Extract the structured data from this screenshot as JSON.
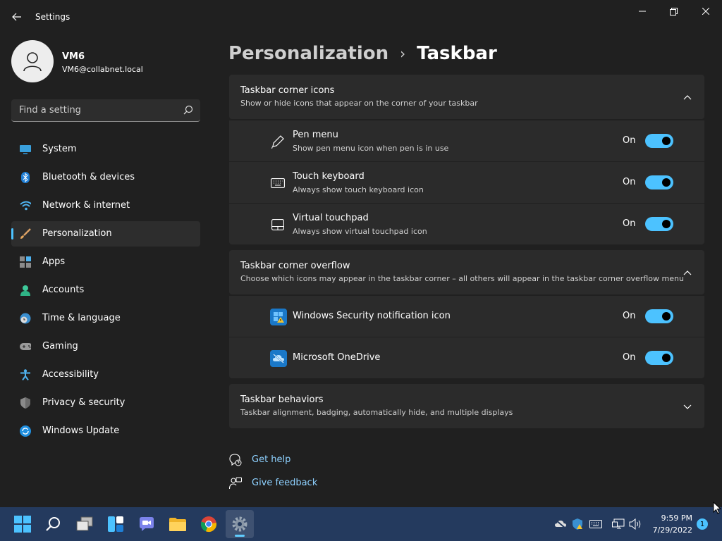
{
  "window": {
    "title": "Settings"
  },
  "profile": {
    "name": "VM6",
    "email": "VM6@collabnet.local"
  },
  "search": {
    "placeholder": "Find a setting"
  },
  "sidebar": {
    "items": [
      {
        "label": "System",
        "icon": "monitor-icon"
      },
      {
        "label": "Bluetooth & devices",
        "icon": "bluetooth-icon"
      },
      {
        "label": "Network & internet",
        "icon": "wifi-icon"
      },
      {
        "label": "Personalization",
        "icon": "paintbrush-icon",
        "active": true
      },
      {
        "label": "Apps",
        "icon": "apps-icon"
      },
      {
        "label": "Accounts",
        "icon": "person-icon"
      },
      {
        "label": "Time & language",
        "icon": "globe-clock-icon"
      },
      {
        "label": "Gaming",
        "icon": "controller-icon"
      },
      {
        "label": "Accessibility",
        "icon": "accessibility-icon"
      },
      {
        "label": "Privacy & security",
        "icon": "shield-icon"
      },
      {
        "label": "Windows Update",
        "icon": "update-icon"
      }
    ]
  },
  "breadcrumb": {
    "parent": "Personalization",
    "separator": "›",
    "current": "Taskbar"
  },
  "sections": {
    "corner_icons": {
      "title": "Taskbar corner icons",
      "subtitle": "Show or hide icons that appear on the corner of your taskbar",
      "rows": [
        {
          "title": "Pen menu",
          "subtitle": "Show pen menu icon when pen is in use",
          "state": "On",
          "icon": "pen-icon"
        },
        {
          "title": "Touch keyboard",
          "subtitle": "Always show touch keyboard icon",
          "state": "On",
          "icon": "keyboard-icon"
        },
        {
          "title": "Virtual touchpad",
          "subtitle": "Always show virtual touchpad icon",
          "state": "On",
          "icon": "touchpad-icon"
        }
      ]
    },
    "corner_overflow": {
      "title": "Taskbar corner overflow",
      "subtitle": "Choose which icons may appear in the taskbar corner – all others will appear in the taskbar corner overflow menu",
      "rows": [
        {
          "title": "Windows Security notification icon",
          "state": "On",
          "icon": "windows-security-icon"
        },
        {
          "title": "Microsoft OneDrive",
          "state": "On",
          "icon": "onedrive-icon"
        }
      ]
    },
    "behaviors": {
      "title": "Taskbar behaviors",
      "subtitle": "Taskbar alignment, badging, automatically hide, and multiple displays"
    }
  },
  "links": {
    "help": "Get help",
    "feedback": "Give feedback"
  },
  "taskbar": {
    "apps": [
      "start-icon",
      "search-icon",
      "task-view-icon",
      "widgets-icon",
      "teams-chat-icon",
      "file-explorer-icon",
      "chrome-icon",
      "settings-icon"
    ],
    "clock_time": "9:59 PM",
    "clock_date": "7/29/2022",
    "notification_count": "1"
  },
  "colors": {
    "accent": "#4cc2ff",
    "link": "#8ed1ff",
    "window_bg": "#202020",
    "card_bg": "#2b2b2b",
    "taskbar_bg": "#243a5e"
  }
}
